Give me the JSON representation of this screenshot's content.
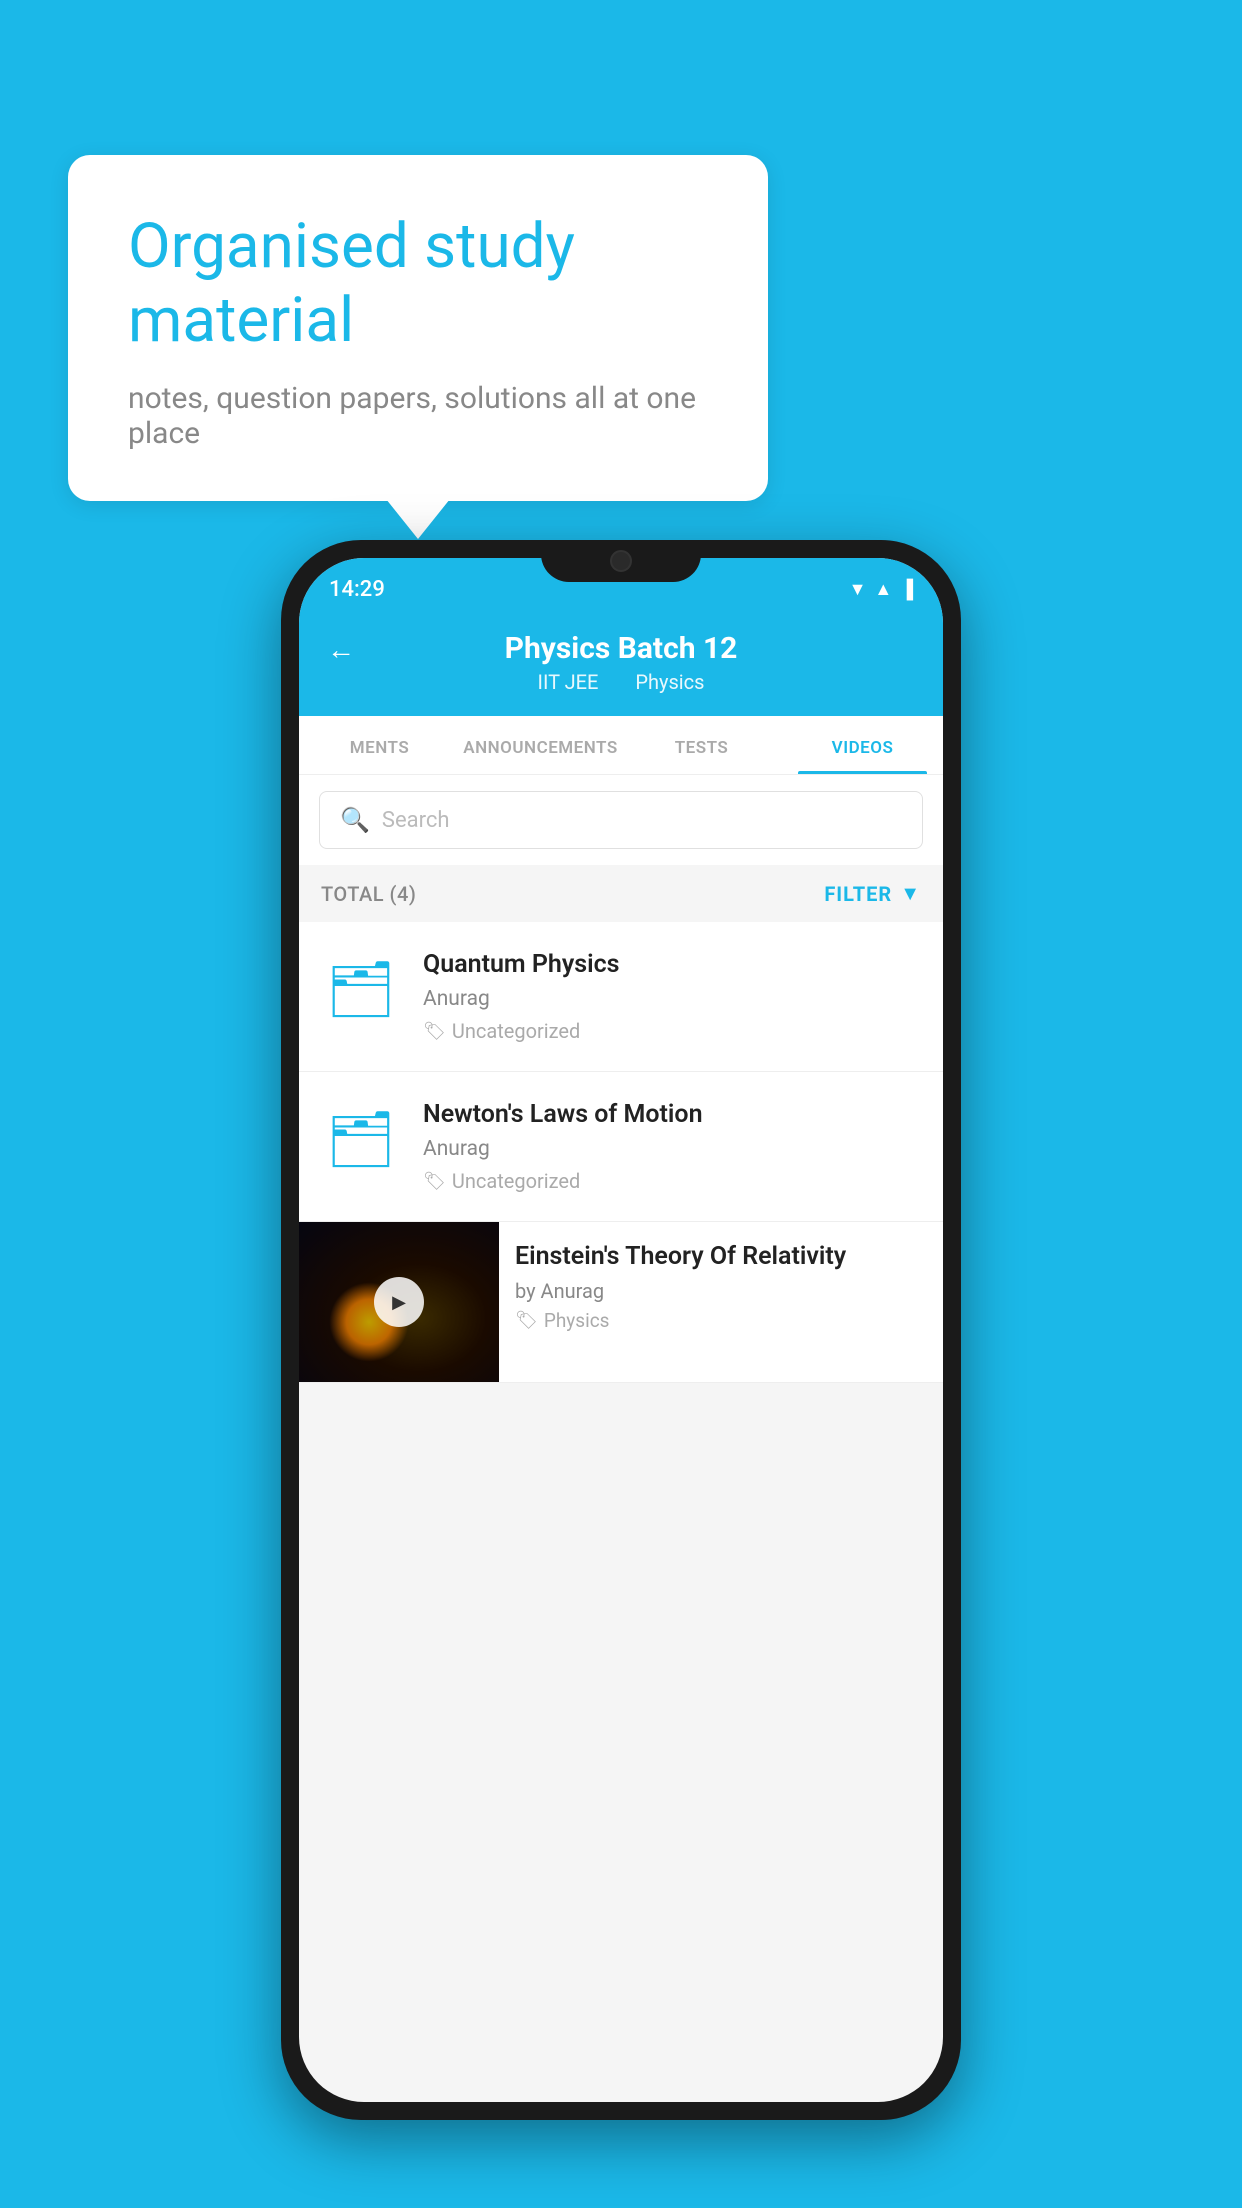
{
  "background": {
    "color": "#1bb8e8"
  },
  "bubble": {
    "title": "Organised study material",
    "subtitle": "notes, question papers, solutions all at one place"
  },
  "phone": {
    "status": {
      "time": "14:29"
    },
    "header": {
      "back_icon": "←",
      "title": "Physics Batch 12",
      "subtitle_part1": "IIT JEE",
      "subtitle_part2": "Physics"
    },
    "tabs": [
      {
        "label": "MENTS",
        "active": false
      },
      {
        "label": "ANNOUNCEMENTS",
        "active": false
      },
      {
        "label": "TESTS",
        "active": false
      },
      {
        "label": "VIDEOS",
        "active": true
      }
    ],
    "search": {
      "placeholder": "Search"
    },
    "filter": {
      "total_label": "TOTAL (4)",
      "filter_label": "FILTER"
    },
    "videos": [
      {
        "type": "folder",
        "title": "Quantum Physics",
        "author": "Anurag",
        "tag": "Uncategorized"
      },
      {
        "type": "folder",
        "title": "Newton's Laws of Motion",
        "author": "Anurag",
        "tag": "Uncategorized"
      },
      {
        "type": "thumbnail",
        "title": "Einstein's Theory Of Relativity",
        "author": "by Anurag",
        "tag": "Physics"
      }
    ]
  }
}
